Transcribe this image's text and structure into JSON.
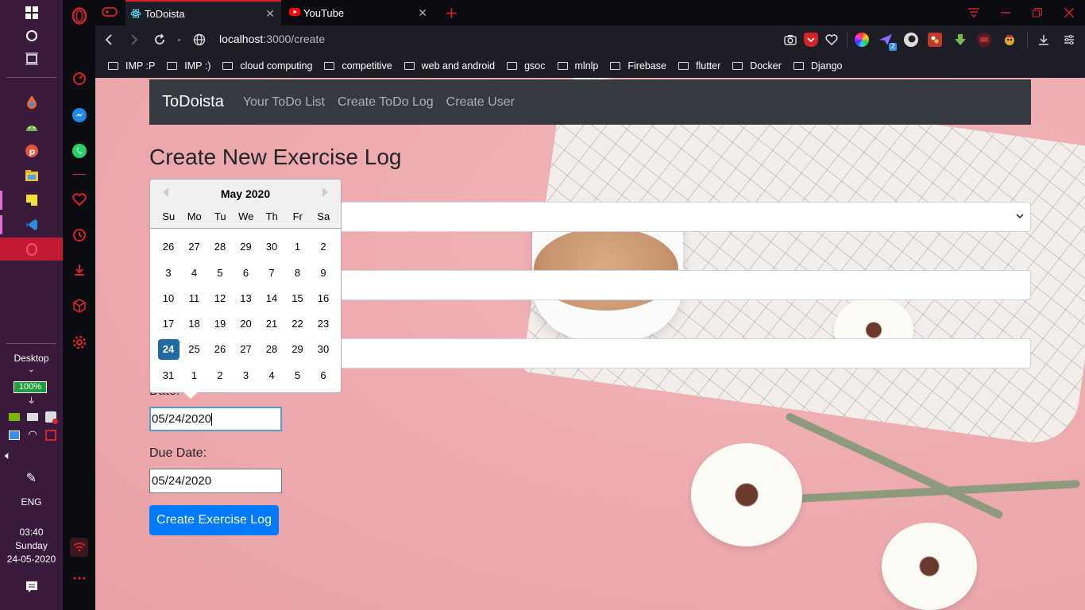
{
  "taskbar": {
    "desktop_label": "Desktop",
    "battery": "100%",
    "language": "ENG",
    "time": "03:40",
    "day": "Sunday",
    "date": "24-05-2020"
  },
  "tabs": [
    {
      "label": "ToDoista",
      "icon": "react-icon"
    },
    {
      "label": "YouTube",
      "icon": "youtube-icon"
    }
  ],
  "address": {
    "host": "localhost",
    "path": ":3000/create"
  },
  "bookmarks": [
    "IMP :P",
    "IMP :)",
    "cloud computing",
    "competitive",
    "web and android",
    "gsoc",
    "mlnlp",
    "Firebase",
    "flutter",
    "Docker",
    "Django"
  ],
  "extension_badge": "2",
  "navbar": {
    "brand": "ToDoista",
    "links": [
      "Your ToDo List",
      "Create ToDo Log",
      "Create User"
    ]
  },
  "page": {
    "title": "Create New Exercise Log",
    "date_label": "Date:",
    "date_value": "05/24/2020",
    "due_date_label": "Due Date:",
    "due_date_value": "05/24/2020",
    "submit_label": "Create Exercise Log"
  },
  "datepicker": {
    "month_label": "May 2020",
    "weekdays": [
      "Su",
      "Mo",
      "Tu",
      "We",
      "Th",
      "Fr",
      "Sa"
    ],
    "weeks": [
      [
        "26",
        "27",
        "28",
        "29",
        "30",
        "1",
        "2"
      ],
      [
        "3",
        "4",
        "5",
        "6",
        "7",
        "8",
        "9"
      ],
      [
        "10",
        "11",
        "12",
        "13",
        "14",
        "15",
        "16"
      ],
      [
        "17",
        "18",
        "19",
        "20",
        "21",
        "22",
        "23"
      ],
      [
        "24",
        "25",
        "26",
        "27",
        "28",
        "29",
        "30"
      ],
      [
        "31",
        "1",
        "2",
        "3",
        "4",
        "5",
        "6"
      ]
    ],
    "selected_day": "24",
    "selected_color": "#216ba5"
  },
  "colors": {
    "accent_red": "#d6232a",
    "navbar_bg": "#343a40",
    "button_primary": "#007bff",
    "page_bg": "#eeacb0"
  }
}
